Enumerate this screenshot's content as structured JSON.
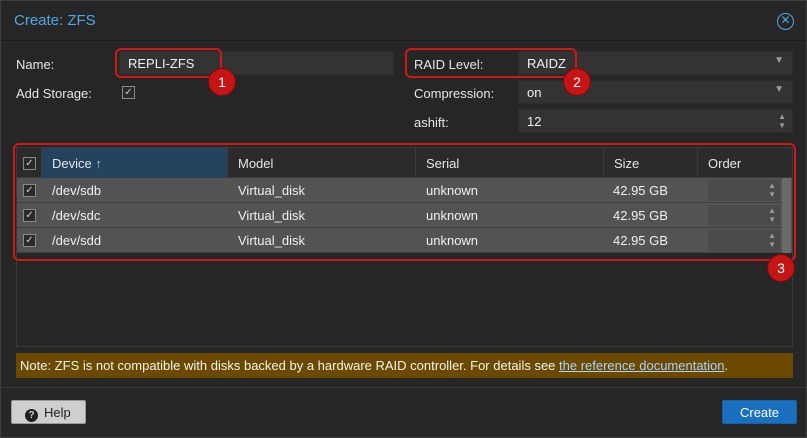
{
  "dialog": {
    "title": "Create: ZFS",
    "close_icon": "close-icon"
  },
  "form": {
    "name_label": "Name:",
    "name_value": "REPLI-ZFS",
    "add_storage_label": "Add Storage:",
    "add_storage_checked": true,
    "raid_label": "RAID Level:",
    "raid_value": "RAIDZ",
    "compression_label": "Compression:",
    "compression_value": "on",
    "ashift_label": "ashift:",
    "ashift_value": "12"
  },
  "grid": {
    "columns": [
      "Device",
      "Model",
      "Serial",
      "Size",
      "Order"
    ],
    "sort_column": "Device",
    "sort_indicator": "↑",
    "rows": [
      {
        "device": "/dev/sdb",
        "model": "Virtual_disk",
        "serial": "unknown",
        "size": "42.95 GB",
        "order": "",
        "checked": true
      },
      {
        "device": "/dev/sdc",
        "model": "Virtual_disk",
        "serial": "unknown",
        "size": "42.95 GB",
        "order": "",
        "checked": true
      },
      {
        "device": "/dev/sdd",
        "model": "Virtual_disk",
        "serial": "unknown",
        "size": "42.95 GB",
        "order": "",
        "checked": true
      }
    ]
  },
  "note": {
    "text": "Note: ZFS is not compatible with disks backed by a hardware RAID controller. For details see ",
    "link_text": "the reference documentation",
    "suffix": "."
  },
  "callouts": [
    "1",
    "2",
    "3"
  ],
  "footer": {
    "help_label": "Help",
    "create_label": "Create"
  },
  "colors": {
    "accent": "#4fa8e6",
    "callout": "#d01818",
    "primary_button": "#1b6fbf",
    "note_background": "#6b4a00"
  }
}
